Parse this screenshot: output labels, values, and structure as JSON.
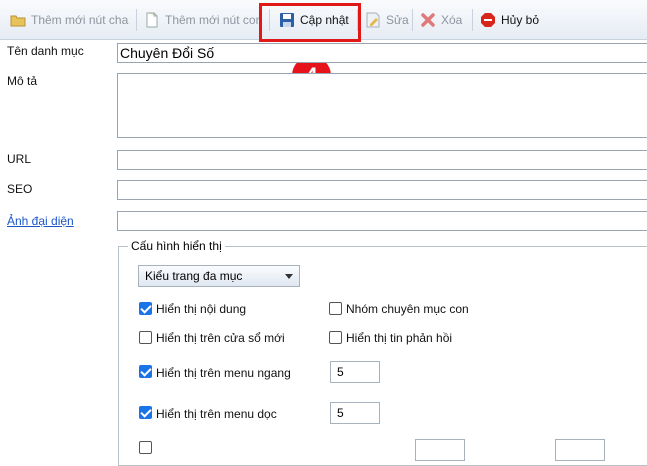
{
  "toolbar": {
    "add_parent_label": "Thêm mới nút cha",
    "add_child_label": "Thêm mới nút con",
    "update_label": "Cập nhật",
    "edit_label": "Sửa",
    "delete_label": "Xóa",
    "cancel_label": "Hủy bỏ"
  },
  "callout_number": "4",
  "form": {
    "category_name_label": "Tên danh mục",
    "category_name_value": "Chuyên Đổi Số",
    "description_label": "Mô tả",
    "description_value": "",
    "url_label": "URL",
    "url_value": "",
    "seo_label": "SEO",
    "seo_value": "",
    "image_label": "Ảnh đại diện",
    "image_value": ""
  },
  "display_config": {
    "legend": "Cấu hình hiển thị",
    "page_type_selected": "Kiểu trang đa mục",
    "options": {
      "show_content": {
        "label": "Hiển thị nội dung",
        "checked": true
      },
      "child_group": {
        "label": "Nhóm chuyên mục con",
        "checked": false
      },
      "new_window": {
        "label": "Hiển thị trên cửa sổ mới",
        "checked": false
      },
      "show_feedback": {
        "label": "Hiển thị tin phản hồi",
        "checked": false
      },
      "horizontal_menu": {
        "label": "Hiển thị trên menu ngang",
        "checked": true,
        "value": "5"
      },
      "vertical_menu": {
        "label": "Hiển thị trên menu dọc",
        "checked": true,
        "value": "5"
      }
    }
  },
  "colors": {
    "highlight": "#e01818",
    "badge": "#e6141a",
    "checkbox_checked": "#1b73e8",
    "link": "#1a55c8"
  }
}
